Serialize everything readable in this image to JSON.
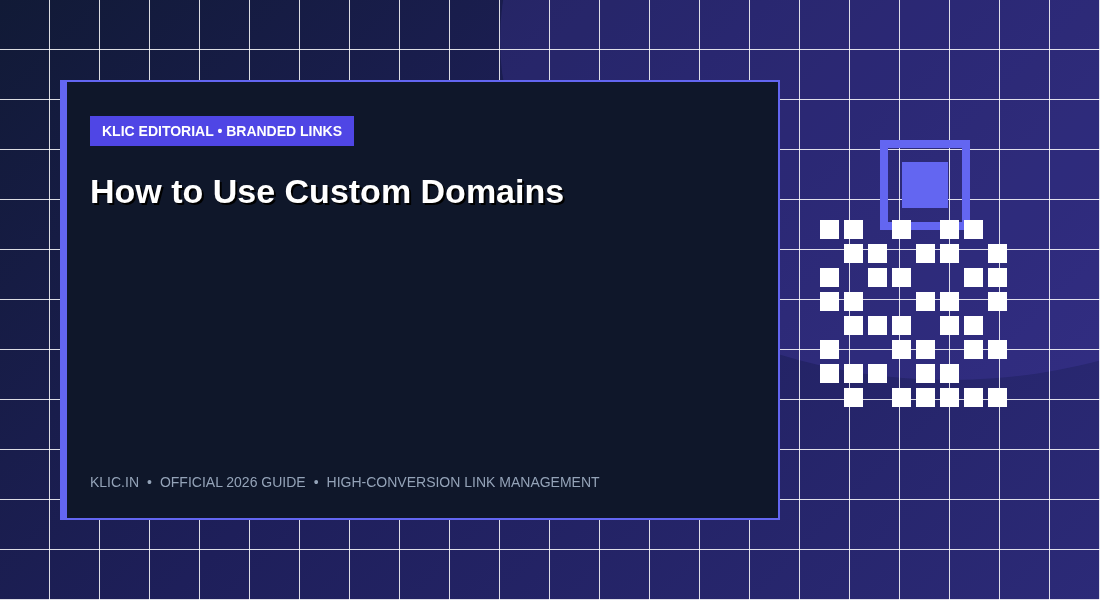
{
  "card": {
    "tag": "KLIC EDITORIAL • BRANDED LINKS",
    "title": "How to Use Custom Domains",
    "footer": {
      "separator": "•",
      "items": [
        "KLIC.IN",
        "OFFICIAL 2026 GUIDE",
        "HIGH-CONVERSION LINK MANAGEMENT"
      ]
    }
  }
}
